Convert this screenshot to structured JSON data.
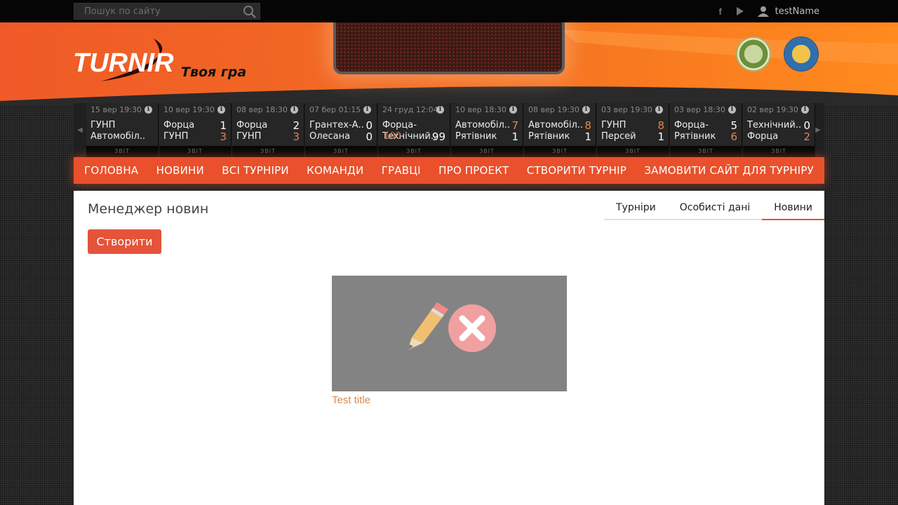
{
  "search": {
    "placeholder": "Пошук по сайту"
  },
  "top": {
    "username": "testName",
    "icons": [
      "facebook-icon",
      "youtube-icon",
      "user-icon"
    ]
  },
  "brand": {
    "logo_text": "TURNIR",
    "tagline": "Твоя гра"
  },
  "ticker": {
    "report_label": "ЗВІТ",
    "matches": [
      {
        "date": "15 вер 19:30",
        "team1": "ГУНП",
        "score1": "",
        "team2": "Автомобіл..",
        "score2": "",
        "lose": 0
      },
      {
        "date": "10 вер 19:30",
        "team1": "Форца",
        "score1": "1",
        "team2": "ГУНП",
        "score2": "3",
        "lose": 2
      },
      {
        "date": "08 вер 18:30",
        "team1": "Форца",
        "score1": "2",
        "team2": "ГУНП",
        "score2": "3",
        "lose": 2
      },
      {
        "date": "07 бер 01:15",
        "team1": "Грантех-А..",
        "score1": "0",
        "team2": "Олесана",
        "score2": "0",
        "lose": 0
      },
      {
        "date": "24 груд 12:04",
        "team1": "Форца-",
        "score1": "",
        "team2": "Технічний..",
        "score2": "99",
        "lose": 0,
        "overlay": "100"
      },
      {
        "date": "10 вер 18:30",
        "team1": "Автомобіл..",
        "score1": "7",
        "team2": "Рятівник",
        "score2": "1",
        "lose": 1
      },
      {
        "date": "08 вер 19:30",
        "team1": "Автомобіл..",
        "score1": "8",
        "team2": "Рятівник",
        "score2": "1",
        "lose": 1
      },
      {
        "date": "03 вер 19:30",
        "team1": "ГУНП",
        "score1": "8",
        "team2": "Персей",
        "score2": "1",
        "lose": 1
      },
      {
        "date": "03 вер 18:30",
        "team1": "Форца-",
        "score1": "5",
        "team2": "Рятівник",
        "score2": "6",
        "lose": 2
      },
      {
        "date": "02 вер 19:30",
        "team1": "Технічний..",
        "score1": "0",
        "team2": "Форца",
        "score2": "2",
        "lose": 2
      }
    ]
  },
  "nav": {
    "items": [
      "ГОЛОВНА",
      "НОВИНИ",
      "ВСІ ТУРНІРИ",
      "КОМАНДИ",
      "ГРАВЦІ",
      "ПРО ПРОЕКТ",
      "СТВОРИТИ ТУРНІР",
      "ЗАМОВИТИ САЙТ ДЛЯ ТУРНІРУ"
    ]
  },
  "main": {
    "title": "Менеджер новин",
    "create_label": "Створити",
    "tabs": [
      "Турніри",
      "Особисті дані",
      "Новини"
    ],
    "active_tab": "Новини",
    "news": [
      {
        "title": "Test title"
      }
    ]
  },
  "colors": {
    "accent": "#e9502b",
    "link": "#d68b55",
    "lose_score": "#e8834f"
  }
}
